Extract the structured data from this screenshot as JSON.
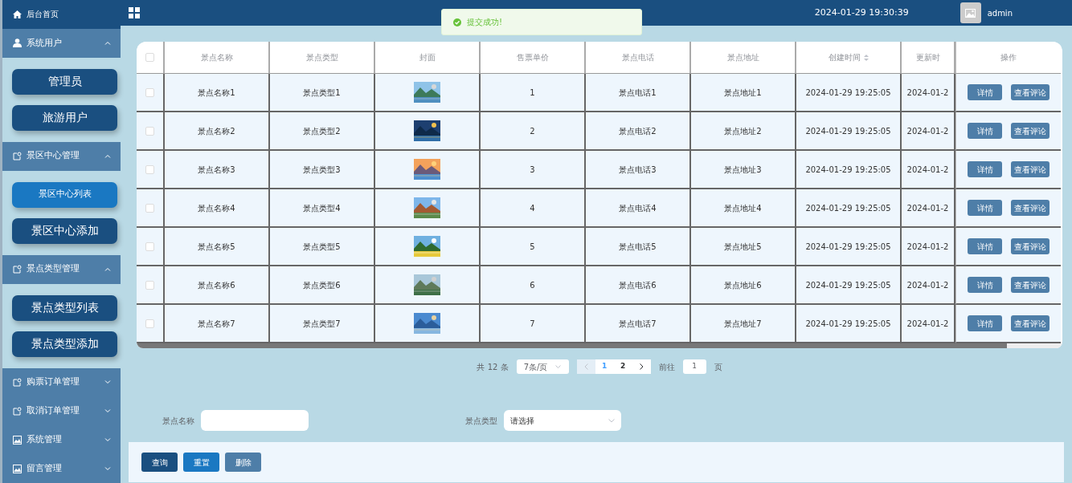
{
  "sidebar": {
    "items": [
      {
        "kind": "link",
        "label": "后台首页"
      },
      {
        "kind": "group",
        "label": "系统用户",
        "expanded": true,
        "children": [
          {
            "label": "管理员",
            "selected": false
          },
          {
            "label": "旅游用户",
            "selected": false
          }
        ]
      },
      {
        "kind": "group",
        "label": "景区中心管理",
        "expanded": true,
        "children": [
          {
            "label": "景区中心列表",
            "selected": true
          },
          {
            "label": "景区中心添加",
            "selected": false
          }
        ]
      },
      {
        "kind": "group",
        "label": "景点类型管理",
        "expanded": true,
        "children": [
          {
            "label": "景点类型列表",
            "selected": false
          },
          {
            "label": "景点类型添加",
            "selected": false
          }
        ]
      },
      {
        "kind": "group",
        "label": "购票订单管理",
        "expanded": false
      },
      {
        "kind": "group",
        "label": "取消订单管理",
        "expanded": false
      },
      {
        "kind": "group",
        "label": "系统管理",
        "expanded": false
      },
      {
        "kind": "group",
        "label": "留言管理",
        "expanded": false
      }
    ]
  },
  "header": {
    "datetime": "2024-01-29 19:30:39",
    "user": "admin"
  },
  "toast": {
    "message": "提交成功!"
  },
  "table": {
    "select_all": {
      "checked": false
    },
    "columns": [
      {
        "label": "景点名称",
        "sortable": false
      },
      {
        "label": "景点类型",
        "sortable": false
      },
      {
        "label": "封面",
        "sortable": false
      },
      {
        "label": "售票单价",
        "sortable": false
      },
      {
        "label": "景点电话",
        "sortable": false
      },
      {
        "label": "景点地址",
        "sortable": false
      },
      {
        "label": "创建时间",
        "sortable": true
      },
      {
        "label": "更新时",
        "sortable": false
      },
      {
        "label": "操作",
        "sortable": false
      }
    ],
    "rows": [
      {
        "checked": false,
        "cells": [
          "景点名称1",
          "景点类型1",
          {
            "kind": "picture"
          },
          "1",
          "景点电话1",
          "景点地址1",
          "2024-01-29 19:25:05",
          "2024-01-2"
        ],
        "actions": [
          "详情",
          "查看评论"
        ]
      },
      {
        "checked": false,
        "cells": [
          "景点名称2",
          "景点类型2",
          {
            "kind": "picture"
          },
          "2",
          "景点电话2",
          "景点地址2",
          "2024-01-29 19:25:05",
          "2024-01-2"
        ],
        "actions": [
          "详情",
          "查看评论"
        ]
      },
      {
        "checked": false,
        "cells": [
          "景点名称3",
          "景点类型3",
          {
            "kind": "picture"
          },
          "3",
          "景点电话3",
          "景点地址3",
          "2024-01-29 19:25:05",
          "2024-01-2"
        ],
        "actions": [
          "详情",
          "查看评论"
        ]
      },
      {
        "checked": false,
        "cells": [
          "景点名称4",
          "景点类型4",
          {
            "kind": "picture"
          },
          "4",
          "景点电话4",
          "景点地址4",
          "2024-01-29 19:25:05",
          "2024-01-2"
        ],
        "actions": [
          "详情",
          "查看评论"
        ]
      },
      {
        "checked": false,
        "cells": [
          "景点名称5",
          "景点类型5",
          {
            "kind": "picture"
          },
          "5",
          "景点电话5",
          "景点地址5",
          "2024-01-29 19:25:05",
          "2024-01-2"
        ],
        "actions": [
          "详情",
          "查看评论"
        ]
      },
      {
        "checked": false,
        "cells": [
          "景点名称6",
          "景点类型6",
          {
            "kind": "picture"
          },
          "6",
          "景点电话6",
          "景点地址6",
          "2024-01-29 19:25:05",
          "2024-01-2"
        ],
        "actions": [
          "详情",
          "查看评论"
        ]
      },
      {
        "checked": false,
        "cells": [
          "景点名称7",
          "景点类型7",
          {
            "kind": "picture"
          },
          "7",
          "景点电话7",
          "景点地址7",
          "2024-01-29 19:25:05",
          "2024-01-2"
        ],
        "actions": [
          "详情",
          "查看评论"
        ]
      }
    ]
  },
  "pagination": {
    "total": "共 12 条",
    "page_size": "7条/页",
    "prev": {
      "disabled": true
    },
    "pages": [
      {
        "label": "1",
        "selected": true
      },
      {
        "label": "2",
        "selected": false
      }
    ],
    "next": {
      "disabled": false
    },
    "goto_label": "前往",
    "goto_value": "1",
    "goto_suffix": "页"
  },
  "search": {
    "fields": [
      {
        "kind": "text",
        "label": "景点名称"
      },
      {
        "kind": "select",
        "label": "景点类型",
        "placeholder": "请选择"
      }
    ],
    "buttons": [
      {
        "label": "查询",
        "color": "#1a4f80"
      },
      {
        "label": "重置",
        "color": "#1a78c2"
      },
      {
        "label": "删除",
        "color": "#4e7ea8"
      }
    ]
  }
}
